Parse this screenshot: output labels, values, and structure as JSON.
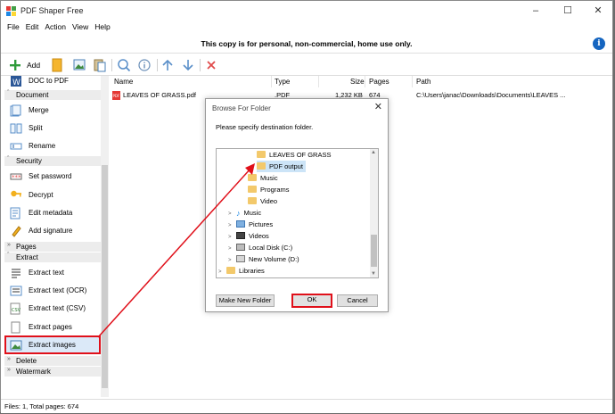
{
  "window": {
    "title": "PDF Shaper Free",
    "controls": [
      "–",
      "☐",
      "✕"
    ]
  },
  "menu": [
    "File",
    "Edit",
    "Action",
    "View",
    "Help"
  ],
  "banner": {
    "text": "This copy is for personal, non-commercial, home use only.",
    "info": "i"
  },
  "toolbar": {
    "add_label": "Add"
  },
  "sidebar": {
    "top_item": "DOC to PDF",
    "document_header": "Document",
    "document_items": [
      "Merge",
      "Split",
      "Rename"
    ],
    "security_header": "Security",
    "security_items": [
      "Set password",
      "Decrypt",
      "Edit metadata",
      "Add signature"
    ],
    "pages_header": "Pages",
    "extract_header": "Extract",
    "extract_items": [
      "Extract text",
      "Extract text (OCR)",
      "Extract text (CSV)",
      "Extract pages",
      "Extract images"
    ],
    "delete_header": "Delete",
    "watermark_header": "Watermark"
  },
  "filelist": {
    "columns": [
      "Name",
      "Type",
      "Size",
      "Pages",
      "Path"
    ],
    "rows": [
      {
        "name": "LEAVES OF GRASS.pdf",
        "type": ".PDF",
        "size": "1,232 KB",
        "pages": "674",
        "path": "C:\\Users\\janac\\Downloads\\Documents\\LEAVES ..."
      }
    ]
  },
  "status": "Files: 1, Total pages: 674",
  "dialog": {
    "title": "Browse For Folder",
    "prompt": "Please specify destination folder.",
    "tree": [
      {
        "label": "LEAVES OF GRASS",
        "icon": "folder-icon"
      },
      {
        "label": "PDF output",
        "icon": "folder-icon",
        "selected": true
      },
      {
        "label": "Music",
        "icon": "folder-icon"
      },
      {
        "label": "Programs",
        "icon": "folder-icon"
      },
      {
        "label": "Video",
        "icon": "folder-icon"
      },
      {
        "label": "Music",
        "icon": "music-icon",
        "expander": ">"
      },
      {
        "label": "Pictures",
        "icon": "pictures-icon",
        "expander": ">"
      },
      {
        "label": "Videos",
        "icon": "videos-icon",
        "expander": ">"
      },
      {
        "label": "Local Disk (C:)",
        "icon": "drive-icon",
        "expander": ">"
      },
      {
        "label": "New Volume (D:)",
        "icon": "drive-icon",
        "expander": ">"
      },
      {
        "label": "Libraries",
        "icon": "libraries-icon",
        "expander": ">"
      }
    ],
    "new_folder_label": "Make New Folder",
    "ok_label": "OK",
    "cancel_label": "Cancel",
    "close": "✕"
  },
  "colors": {
    "highlight": "#e0101a",
    "accent": "#1565c0",
    "folder": "#f3c96b"
  }
}
